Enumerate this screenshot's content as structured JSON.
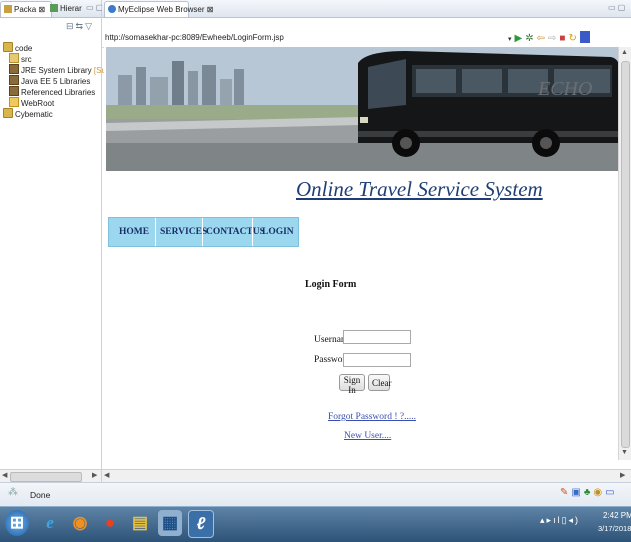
{
  "left_panel": {
    "tabs": [
      {
        "label": "Packa ⊠"
      },
      {
        "label": "Hierar"
      }
    ],
    "tree": [
      {
        "label": "code",
        "icon": "project-icon"
      },
      {
        "label": "src",
        "icon": "source-folder-icon"
      },
      {
        "label": "JRE System Library",
        "suffix": "[Sun J",
        "icon": "library-icon"
      },
      {
        "label": "Java EE 5 Libraries",
        "icon": "library-icon"
      },
      {
        "label": "Referenced Libraries",
        "icon": "library-icon"
      },
      {
        "label": "WebRoot",
        "icon": "folder-icon"
      },
      {
        "label": "Cybematic",
        "icon": "project-icon"
      }
    ]
  },
  "browser": {
    "tab_label": "MyEclipse Web Browser ⊠",
    "url": "http://somasekhar-pc:8089/Ewheeb/LoginForm.jsp"
  },
  "page": {
    "site_title": "Online Travel Service System",
    "nav": [
      "HOME",
      "SERVICES",
      "CONTACTUS",
      "LOGIN"
    ],
    "login_heading": "Login Form",
    "username_label": "Username",
    "password_label": "Password",
    "username_value": "",
    "password_value": "",
    "signin_label": "Sign In",
    "clear_label": "Clear",
    "forgot_link": "Forgot Password ! ?.....",
    "new_user_link": "New User....",
    "banner_brand": "ECHO"
  },
  "status": {
    "text": "Done"
  },
  "taskbar": {
    "time": "2:42 PM",
    "date": "3/17/2018"
  }
}
